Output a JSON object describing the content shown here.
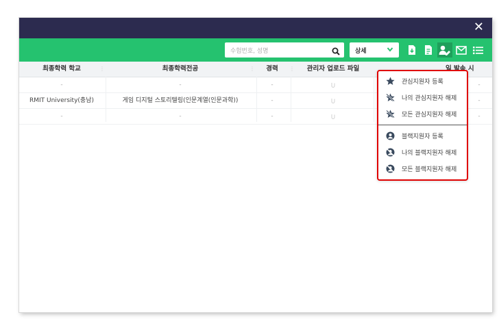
{
  "window": {
    "close_label": "✕"
  },
  "toolbar": {
    "search_placeholder": "수험번호, 성명",
    "detail_label": "상세",
    "icons": [
      "download-icon",
      "document-icon",
      "user-settings-icon",
      "mail-icon",
      "list-icon"
    ]
  },
  "table": {
    "columns": [
      "최종학력 학교",
      "최종학력전공",
      "경력",
      "관리자 업로드 파일",
      "일 발송 시"
    ],
    "rows": [
      [
        "-",
        "-",
        "-",
        "",
        "-"
      ],
      [
        "RMIT University(충남)",
        "게임 디지털 스토리텔링(인문계열(인문과학))",
        "-",
        "",
        "-"
      ],
      [
        "-",
        "-",
        "-",
        "",
        "-"
      ]
    ]
  },
  "menu": {
    "items": [
      {
        "label": "관심지원자 등록",
        "icon": "star-icon"
      },
      {
        "label": "나의 관심지원자 해제",
        "icon": "star-off-icon"
      },
      {
        "label": "모든 관심지원자 해제",
        "icon": "star-off-icon"
      },
      {
        "label": "블랙지원자 등록",
        "icon": "user-circle-icon"
      },
      {
        "label": "나의 블랙지원자 해제",
        "icon": "user-block-icon"
      },
      {
        "label": "모든 블랙지원자 해제",
        "icon": "user-block-icon"
      }
    ]
  },
  "colors": {
    "titlebar": "#2c2b4f",
    "toolbar": "#25c26f",
    "highlight": "#e00000"
  }
}
